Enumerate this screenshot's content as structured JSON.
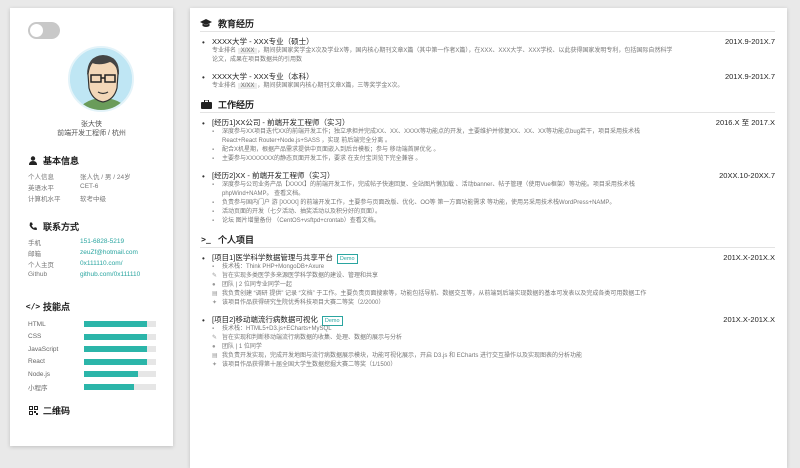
{
  "colors": {
    "accent": "#2aa5a0",
    "bar_fill": "#2bb5a9",
    "bar_track": "#e6e6e6"
  },
  "profile": {
    "name": "张大侠",
    "role": "前端开发工程师 / 杭州"
  },
  "basic": {
    "title": "基本信息",
    "rows": [
      {
        "k": "个人信息",
        "v": "张人仇 / 男 / 24岁"
      },
      {
        "k": "英语水平",
        "v": "CET-6"
      },
      {
        "k": "计算机水平",
        "v": "软考中级"
      }
    ]
  },
  "contact": {
    "title": "联系方式",
    "rows": [
      {
        "k": "手机",
        "v": "151-6828-5219"
      },
      {
        "k": "邮箱",
        "v": "zeuZf@hotmail.com"
      },
      {
        "k": "个人主页",
        "v": "0x111110.com/"
      },
      {
        "k": "Github",
        "v": "github.com/0x111110"
      }
    ]
  },
  "skills": {
    "title": "技能点",
    "items": [
      {
        "k": "HTML",
        "level": 0.88
      },
      {
        "k": "CSS",
        "level": 0.88
      },
      {
        "k": "JavaScript",
        "level": 0.88
      },
      {
        "k": "React",
        "level": 0.88
      },
      {
        "k": "Node.js",
        "level": 0.75
      },
      {
        "k": "小程序",
        "level": 0.7
      }
    ]
  },
  "qr": {
    "title": "二维码"
  },
  "education": {
    "title": "教育经历",
    "items": [
      {
        "school": "XXXX大学 - XXX专业（硕士）",
        "date": "201X.9-201X.7",
        "l1": "专业排名",
        "tag": "X/XX",
        "l2": "，期间获国家奖学金X次及学业X等，国内核心期刊文章X篇（其中第一作者X篇），在XXX、XXX大学、XXX学校、以此获得国家发明专利，包括国际自然科学",
        "l3": "论文，成果在项目数据共的引用数"
      },
      {
        "school": "XXXX大学 - XXX专业（本科）",
        "date": "201X.9-201X.7",
        "l1": "专业排名",
        "tag": "X/XX",
        "l2": "，期间获国家国内核心期刊文章X篇，三等奖学金X次。"
      }
    ]
  },
  "work": {
    "title": "工作经历",
    "items": [
      {
        "title": "[经历1]XX公司 - 前端开发工程师（实习）",
        "date": "2016.X 至 2017.X",
        "lines": [
          "深度参与XX项目迭代XX的前端开发工作；独立承担并完成XX、XX、XXXX等功能点的开发，主要维护并修复XX、XX、XX等功能点bug若干，项目采用技术栈",
          "React+React Router+Node.js+SASS ，实现 前后端完全分离 。",
          "配合X机星期，根据产品需求提供中页面嵌入到后台模板；参与 移动端首屏优化 。",
          "主要参与XXXXXXX的静态页面开发工作，要求 在支付宝浏览下完全兼容 。"
        ]
      },
      {
        "title": "[经历2]XX - 前端开发工程师（实习）",
        "date": "20XX.10-20XX.7",
        "lines": [
          "深度参与公司业务产品【XXXX】的前端开发工作，完成帖子快速回复、全站图片懒加载 、活动banner、帖子管理（使用Vue框架）等功能。项目采用技术栈",
          "phpWind+NAMP。 查看文档。",
          "负责参与国内门户 游 [XXXX] 的前端开发工作，主要参与页面改版、优化、OO等 第一方面功能需求 等功能，使用另采用技术栈WordPress+NAMP。",
          "活动页面的开发（七夕活动、抽奖活动以及积分好的页面）。",
          "论坛 图片增量备份 （CentOS+vsftpd+crontab）查看文档。"
        ]
      }
    ]
  },
  "projects": {
    "title": "个人项目",
    "items": [
      {
        "title": "[项目1]医学科学数据管理与共享平台",
        "demo": "Demo",
        "date": "201X.X-201X.X",
        "lines": [
          "技术栈：Think PHP+MongoDB+Axure",
          "旨在实现多类医学多来源医学科学数据的建设、管理和共享",
          "团队 | 2 位同专业同学一起",
          "我负责创建 “调研 提供” 记录 “文档” 于工作。主要负责页面搜索等，功能包括导航、数据交互等，从前端到后端实现数据的基本可发表以及完成各类可用数据工作",
          "该项目作品获得研究生院优秀科技项目大赛二等奖（2/2000）"
        ]
      },
      {
        "title": "[项目2]移动端流行病数据可视化",
        "demo": "Demo",
        "date": "201X.X-201X.X",
        "lines": [
          "技术栈：HTML5+D3.js+ECharts+MySQL",
          "旨在实现和判断移动端流行病数据的收集、处理、数据的展示与分析",
          "团队 | 1 位同学",
          "我负责开发实现，完成开发地图与流行病数据展示模块，功能可视化展示，开启 D3.js 和 ECharts 进行交互操作以及实现图表的分析功能",
          "该项目作品获得第十届全国大学生数据挖掘大赛二等奖（1/1500）"
        ]
      }
    ]
  }
}
